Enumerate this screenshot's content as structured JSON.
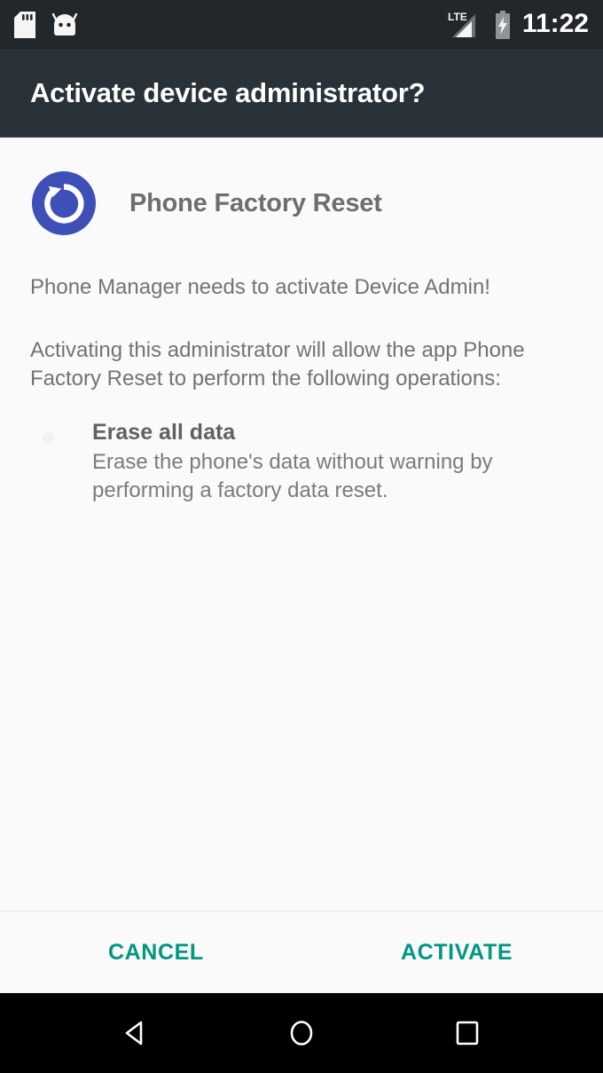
{
  "status_bar": {
    "left_icons": [
      {
        "name": "sd-card-icon"
      },
      {
        "name": "android-head-icon"
      }
    ],
    "network_label": "LTE",
    "right_icons": [
      {
        "name": "signal-bars-icon"
      },
      {
        "name": "battery-charging-icon"
      }
    ],
    "clock": "11:22"
  },
  "header": {
    "title": "Activate device administrator?"
  },
  "app": {
    "icon_name": "factory-reset-icon",
    "icon_color": "#3f4fb8",
    "name": "Phone Factory Reset"
  },
  "body": {
    "lead": "Phone Manager needs to activate Device Admin!",
    "description": "Activating this administrator will allow the app Phone Factory Reset to perform the following operations:",
    "policies": [
      {
        "title": "Erase all data",
        "description": "Erase the phone's data without warning by performing a factory data reset."
      }
    ]
  },
  "actions": {
    "cancel_label": "CANCEL",
    "activate_label": "ACTIVATE",
    "accent_color": "#009783"
  },
  "nav_bar": {
    "back_label": "Back",
    "home_label": "Home",
    "recents_label": "Recents"
  }
}
